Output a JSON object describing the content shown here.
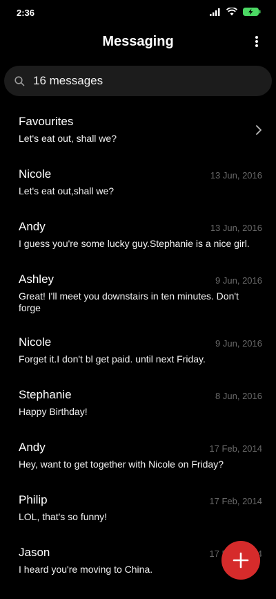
{
  "status": {
    "time": "2:36"
  },
  "header": {
    "title": "Messaging"
  },
  "search": {
    "text": "16 messages"
  },
  "favourites": {
    "name": "Favourites",
    "snippet": "Let's eat out, shall we?"
  },
  "conversations": [
    {
      "name": "Nicole",
      "date": "13 Jun, 2016",
      "snippet": "Let's eat out,shall we?"
    },
    {
      "name": "Andy",
      "date": "13 Jun, 2016",
      "snippet": "I guess you're some lucky guy.Stephanie is a nice girl."
    },
    {
      "name": "Ashley",
      "date": "9 Jun, 2016",
      "snippet": "Great! I'll meet you downstairs in ten minutes. Don't forge"
    },
    {
      "name": "Nicole",
      "date": "9 Jun, 2016",
      "snippet": "Forget it.I don't bl get paid. until next Friday."
    },
    {
      "name": "Stephanie",
      "date": "8 Jun, 2016",
      "snippet": "Happy Birthday!"
    },
    {
      "name": "Andy",
      "date": "17 Feb, 2014",
      "snippet": "Hey, want to get together with Nicole on Friday?"
    },
    {
      "name": "Philip",
      "date": "17 Feb, 2014",
      "snippet": "LOL, that's so funny!"
    },
    {
      "name": "Jason",
      "date": "17 Feb, 2014",
      "snippet": "I heard you're moving to China."
    }
  ],
  "icons": {
    "signal": "signal-icon",
    "wifi": "wifi-icon",
    "battery": "battery-charging-icon",
    "menu": "more-vertical-icon",
    "search": "search-icon",
    "chevron": "chevron-right-icon",
    "compose": "plus-icon"
  },
  "colors": {
    "accent": "#d62b2b",
    "battery": "#4cd964"
  }
}
